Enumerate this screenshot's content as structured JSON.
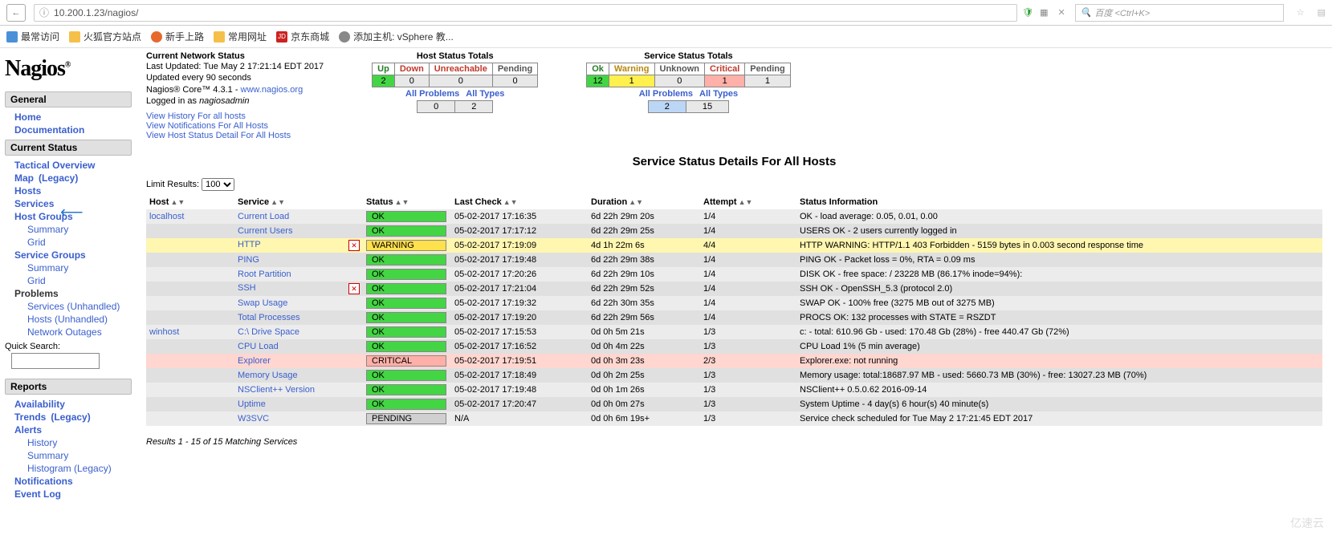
{
  "browser": {
    "url": "10.200.1.23/nagios/",
    "search_placeholder": "百度 <Ctrl+K>"
  },
  "bookmarks": [
    {
      "label": "最常访问"
    },
    {
      "label": "火狐官方站点"
    },
    {
      "label": "新手上路"
    },
    {
      "label": "常用网址"
    },
    {
      "label": "京东商城"
    },
    {
      "label": "添加主机: vSphere 教..."
    }
  ],
  "logo": "Nagios",
  "nav": {
    "sections": [
      "General",
      "Current Status",
      "Reports"
    ],
    "general": [
      "Home",
      "Documentation"
    ],
    "current_status": {
      "tactical": "Tactical Overview",
      "map": "Map",
      "legacy": "(Legacy)",
      "hosts": "Hosts",
      "services": "Services",
      "host_groups": "Host Groups",
      "hg_sub": [
        "Summary",
        "Grid"
      ],
      "service_groups": "Service Groups",
      "sg_sub": [
        "Summary",
        "Grid"
      ],
      "problems": "Problems",
      "prob_sub": [
        "Services (Unhandled)",
        "Hosts (Unhandled)",
        "Network Outages"
      ],
      "quick_search": "Quick Search:"
    },
    "reports": [
      "Availability",
      "Trends",
      "Alerts",
      "History",
      "Summary",
      "Histogram (Legacy)",
      "Notifications",
      "Event Log"
    ],
    "trends_legacy": "(Legacy)"
  },
  "status_block": {
    "title": "Current Network Status",
    "last_updated": "Last Updated: Tue May 2 17:21:14 EDT 2017",
    "update_every": "Updated every 90 seconds",
    "product": "Nagios® Core™ 4.3.1 - ",
    "product_link": "www.nagios.org",
    "logged_in_pre": "Logged in as ",
    "logged_in_user": "nagiosadmin",
    "links": [
      "View History For all hosts",
      "View Notifications For All Hosts",
      "View Host Status Detail For All Hosts"
    ]
  },
  "host_totals": {
    "title": "Host Status Totals",
    "headers": [
      "Up",
      "Down",
      "Unreachable",
      "Pending"
    ],
    "values": [
      "2",
      "0",
      "0",
      "0"
    ],
    "sub_labels": [
      "All Problems",
      "All Types"
    ],
    "sub_values": [
      "0",
      "2"
    ]
  },
  "service_totals": {
    "title": "Service Status Totals",
    "headers": [
      "Ok",
      "Warning",
      "Unknown",
      "Critical",
      "Pending"
    ],
    "values": [
      "12",
      "1",
      "0",
      "1",
      "1"
    ],
    "sub_labels": [
      "All Problems",
      "All Types"
    ],
    "sub_values": [
      "2",
      "15"
    ]
  },
  "page_title": "Service Status Details For All Hosts",
  "limit": {
    "label": "Limit Results:",
    "value": "100"
  },
  "columns": [
    "Host",
    "Service",
    "Status",
    "Last Check",
    "Duration",
    "Attempt",
    "Status Information"
  ],
  "rows": [
    {
      "host": "localhost",
      "service": "Current Load",
      "status": "OK",
      "pill": "ok",
      "check": "05-02-2017 17:16:35",
      "dur": "6d 22h 29m 20s",
      "att": "1/4",
      "info": "OK - load average: 0.05, 0.01, 0.00",
      "icon": false,
      "cls": "even"
    },
    {
      "host": "",
      "service": "Current Users",
      "status": "OK",
      "pill": "ok",
      "check": "05-02-2017 17:17:12",
      "dur": "6d 22h 29m 25s",
      "att": "1/4",
      "info": "USERS OK - 2 users currently logged in",
      "icon": false,
      "cls": "odd"
    },
    {
      "host": "",
      "service": "HTTP",
      "status": "WARNING",
      "pill": "warn",
      "check": "05-02-2017 17:19:09",
      "dur": "4d 1h 22m 6s",
      "att": "4/4",
      "info": "HTTP WARNING: HTTP/1.1 403 Forbidden - 5159 bytes in 0.003 second response time",
      "icon": true,
      "cls": "warn"
    },
    {
      "host": "",
      "service": "PING",
      "status": "OK",
      "pill": "ok",
      "check": "05-02-2017 17:19:48",
      "dur": "6d 22h 29m 38s",
      "att": "1/4",
      "info": "PING OK - Packet loss = 0%, RTA = 0.09 ms",
      "icon": false,
      "cls": "odd"
    },
    {
      "host": "",
      "service": "Root Partition",
      "status": "OK",
      "pill": "ok",
      "check": "05-02-2017 17:20:26",
      "dur": "6d 22h 29m 10s",
      "att": "1/4",
      "info": "DISK OK - free space: / 23228 MB (86.17% inode=94%):",
      "icon": false,
      "cls": "even"
    },
    {
      "host": "",
      "service": "SSH",
      "status": "OK",
      "pill": "ok",
      "check": "05-02-2017 17:21:04",
      "dur": "6d 22h 29m 52s",
      "att": "1/4",
      "info": "SSH OK - OpenSSH_5.3 (protocol 2.0)",
      "icon": true,
      "cls": "odd"
    },
    {
      "host": "",
      "service": "Swap Usage",
      "status": "OK",
      "pill": "ok",
      "check": "05-02-2017 17:19:32",
      "dur": "6d 22h 30m 35s",
      "att": "1/4",
      "info": "SWAP OK - 100% free (3275 MB out of 3275 MB)",
      "icon": false,
      "cls": "even"
    },
    {
      "host": "",
      "service": "Total Processes",
      "status": "OK",
      "pill": "ok",
      "check": "05-02-2017 17:19:20",
      "dur": "6d 22h 29m 56s",
      "att": "1/4",
      "info": "PROCS OK: 132 processes with STATE = RSZDT",
      "icon": false,
      "cls": "odd"
    },
    {
      "host": "winhost",
      "service": "C:\\ Drive Space",
      "status": "OK",
      "pill": "ok",
      "check": "05-02-2017 17:15:53",
      "dur": "0d 0h 5m 21s",
      "att": "1/3",
      "info": "c: - total: 610.96 Gb - used: 170.48 Gb (28%) - free 440.47 Gb (72%)",
      "icon": false,
      "cls": "even"
    },
    {
      "host": "",
      "service": "CPU Load",
      "status": "OK",
      "pill": "ok",
      "check": "05-02-2017 17:16:52",
      "dur": "0d 0h 4m 22s",
      "att": "1/3",
      "info": "CPU Load 1% (5 min average)",
      "icon": false,
      "cls": "odd"
    },
    {
      "host": "",
      "service": "Explorer",
      "status": "CRITICAL",
      "pill": "crit",
      "check": "05-02-2017 17:19:51",
      "dur": "0d 0h 3m 23s",
      "att": "2/3",
      "info": "Explorer.exe: not running",
      "icon": false,
      "cls": "crit"
    },
    {
      "host": "",
      "service": "Memory Usage",
      "status": "OK",
      "pill": "ok",
      "check": "05-02-2017 17:18:49",
      "dur": "0d 0h 2m 25s",
      "att": "1/3",
      "info": "Memory usage: total:18687.97 MB - used: 5660.73 MB (30%) - free: 13027.23 MB (70%)",
      "icon": false,
      "cls": "odd"
    },
    {
      "host": "",
      "service": "NSClient++ Version",
      "status": "OK",
      "pill": "ok",
      "check": "05-02-2017 17:19:48",
      "dur": "0d 0h 1m 26s",
      "att": "1/3",
      "info": "NSClient++ 0.5.0.62 2016-09-14",
      "icon": false,
      "cls": "even"
    },
    {
      "host": "",
      "service": "Uptime",
      "status": "OK",
      "pill": "ok",
      "check": "05-02-2017 17:20:47",
      "dur": "0d 0h 0m 27s",
      "att": "1/3",
      "info": "System Uptime - 4 day(s) 6 hour(s) 40 minute(s)",
      "icon": false,
      "cls": "odd"
    },
    {
      "host": "",
      "service": "W3SVC",
      "status": "PENDING",
      "pill": "pend",
      "check": "N/A",
      "dur": "0d 0h 6m 19s+",
      "att": "1/3",
      "info": "Service check scheduled for Tue May 2 17:21:45 EDT 2017",
      "icon": false,
      "cls": "even"
    }
  ],
  "footer": "Results 1 - 15 of 15 Matching Services",
  "watermark": "亿速云"
}
